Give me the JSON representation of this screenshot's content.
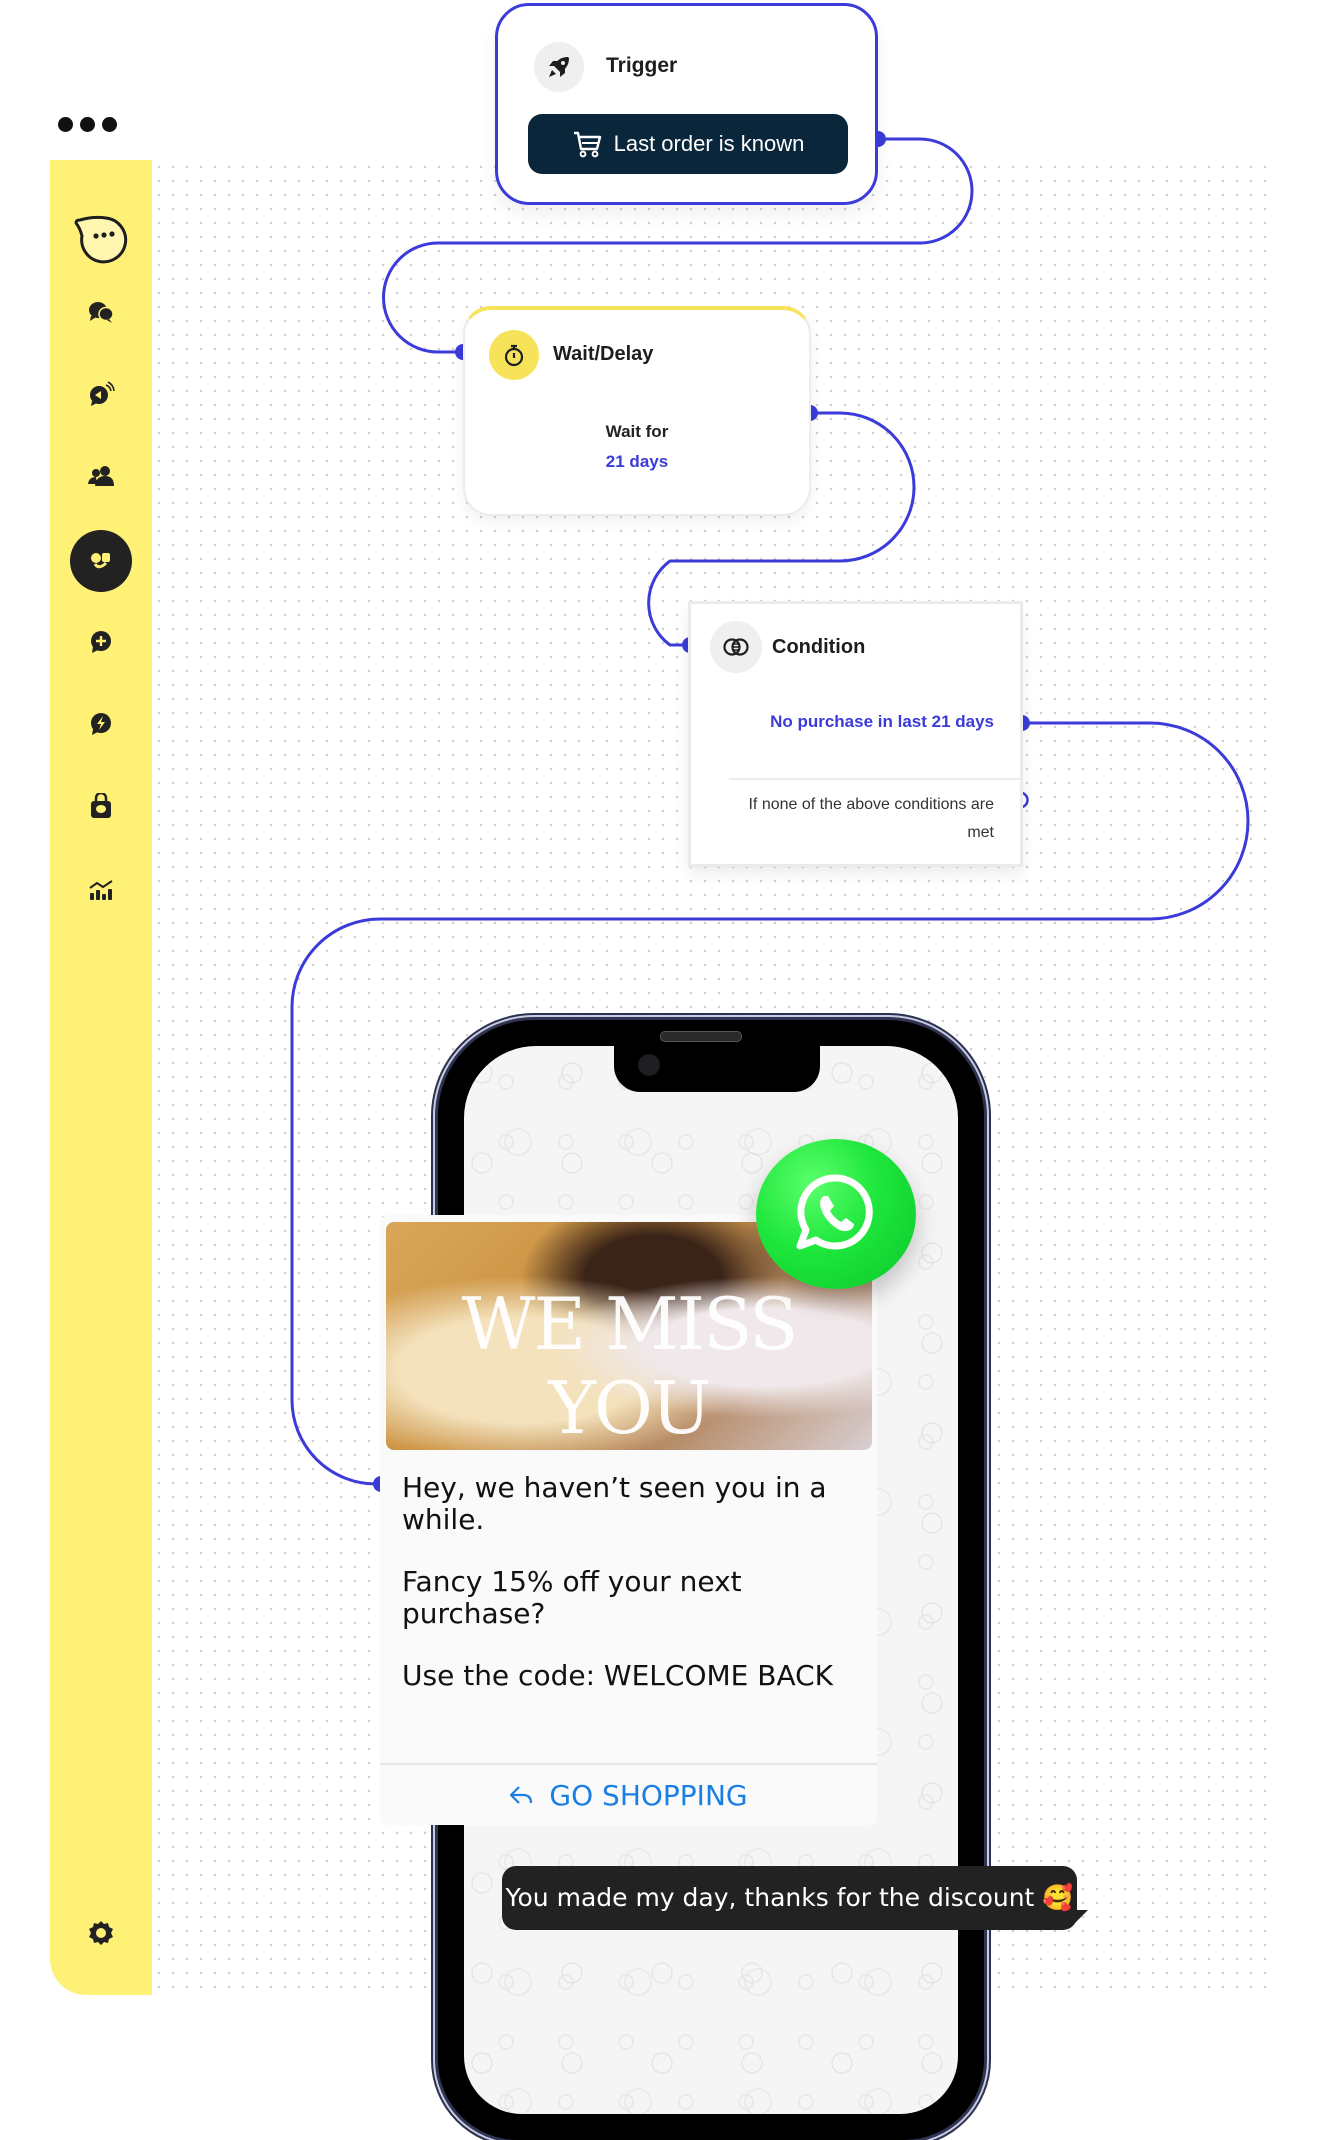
{
  "colors": {
    "accent": "#3b3bd9",
    "sidebar": "#fff176",
    "trigger_pill": "#0a263b",
    "whatsapp": "#1ee63c",
    "cta": "#1a7fe3"
  },
  "window": {
    "menu_icon": "more-dots-icon"
  },
  "sidebar": {
    "logo_icon": "chat-bubble-logo-icon",
    "items": [
      {
        "icon": "conversations-icon",
        "active": false
      },
      {
        "icon": "broadcast-icon",
        "active": false
      },
      {
        "icon": "contacts-icon",
        "active": false
      },
      {
        "icon": "flows-icon",
        "active": true
      },
      {
        "icon": "add-chat-icon",
        "active": false
      },
      {
        "icon": "automation-icon",
        "active": false
      },
      {
        "icon": "shop-icon",
        "active": false
      },
      {
        "icon": "analytics-icon",
        "active": false
      }
    ],
    "settings_icon": "gear-icon"
  },
  "flow": {
    "trigger": {
      "title": "Trigger",
      "icon": "rocket-icon",
      "event_label": "Last order is known",
      "event_icon": "cart-icon"
    },
    "wait": {
      "title": "Wait/Delay",
      "icon": "stopwatch-icon",
      "label": "Wait for",
      "value": "21 days"
    },
    "condition": {
      "title": "Condition",
      "icon": "intersect-circles-icon",
      "branches": [
        "No purchase in last 21 days"
      ],
      "else_label": "If none of the above conditions are met"
    }
  },
  "message": {
    "hero_text": "WE MISS YOU",
    "paragraphs": [
      "Hey, we haven’t seen you in a while.",
      "Fancy 15% off your next purchase?",
      "Use the code: WELCOME BACK"
    ],
    "cta_label": "GO SHOPPING",
    "cta_icon": "reply-arrow-icon",
    "channel_icon": "whatsapp-icon"
  },
  "reply": {
    "text": "You made my day, thanks for the discount 🥰"
  }
}
